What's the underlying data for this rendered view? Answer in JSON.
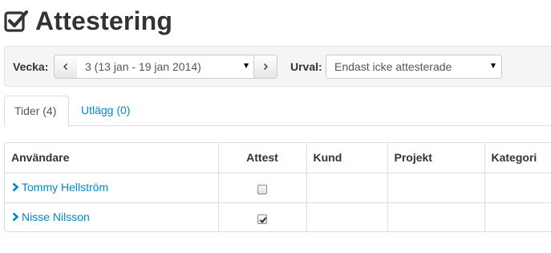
{
  "header": {
    "title": "Attestering",
    "icon": "checkbox-checked-icon"
  },
  "filters": {
    "week_label": "Vecka:",
    "prev_icon": "chevron-left-icon",
    "next_icon": "chevron-right-icon",
    "week_value": "3 (13 jan - 19 jan 2014)",
    "filter_label": "Urval:",
    "filter_value": "Endast icke attesterade"
  },
  "tabs": [
    {
      "label": "Tider (4)",
      "active": true
    },
    {
      "label": "Utlägg (0)",
      "active": false
    }
  ],
  "table": {
    "columns": [
      "Användare",
      "Attest",
      "Kund",
      "Projekt",
      "Kategori"
    ],
    "rows": [
      {
        "user": "Tommy Hellström",
        "attest": false,
        "kund": "",
        "projekt": "",
        "kategori": ""
      },
      {
        "user": "Nisse Nilsson",
        "attest": true,
        "kund": "",
        "projekt": "",
        "kategori": ""
      }
    ]
  },
  "colors": {
    "link": "#0088cc",
    "text": "#333333",
    "border": "#dddddd",
    "well": "#f5f5f5"
  }
}
